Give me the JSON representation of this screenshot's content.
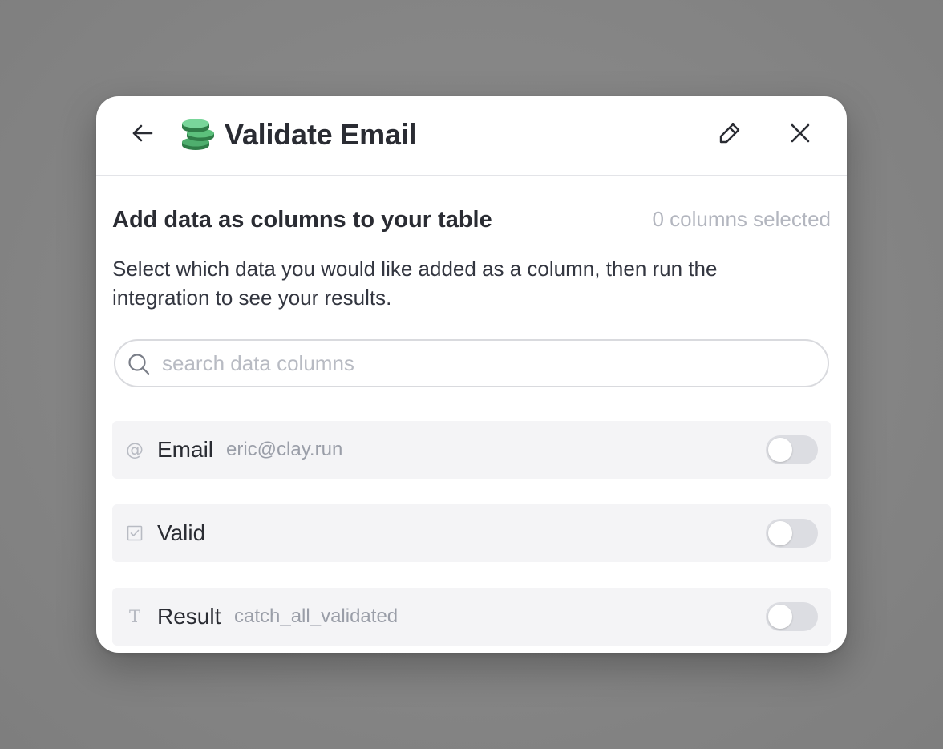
{
  "header": {
    "title": "Validate Email",
    "back_icon": "arrow-left-icon",
    "logo_icon": "coin-stack-logo",
    "edit_icon": "pencil-icon",
    "close_icon": "close-icon"
  },
  "section": {
    "title": "Add data as columns to your table",
    "selected_count": "0 columns selected",
    "description": "Select which data you would like added as a column, then run the integration to see your results."
  },
  "search": {
    "placeholder": "search data columns",
    "value": "",
    "icon": "search-icon"
  },
  "columns": [
    {
      "type_icon": "at-sign-icon",
      "glyph": "@",
      "name": "Email",
      "value": "eric@clay.run",
      "enabled": false
    },
    {
      "type_icon": "checkbox-icon",
      "glyph": "",
      "name": "Valid",
      "value": "",
      "enabled": false
    },
    {
      "type_icon": "text-type-icon",
      "glyph": "T",
      "name": "Result",
      "value": "catch_all_validated",
      "enabled": false
    }
  ],
  "colors": {
    "accent_green": "#3a9b5c",
    "toggle_off": "#dcdde2",
    "row_background": "#f4f4f6",
    "muted_text": "#9a9ea8"
  }
}
